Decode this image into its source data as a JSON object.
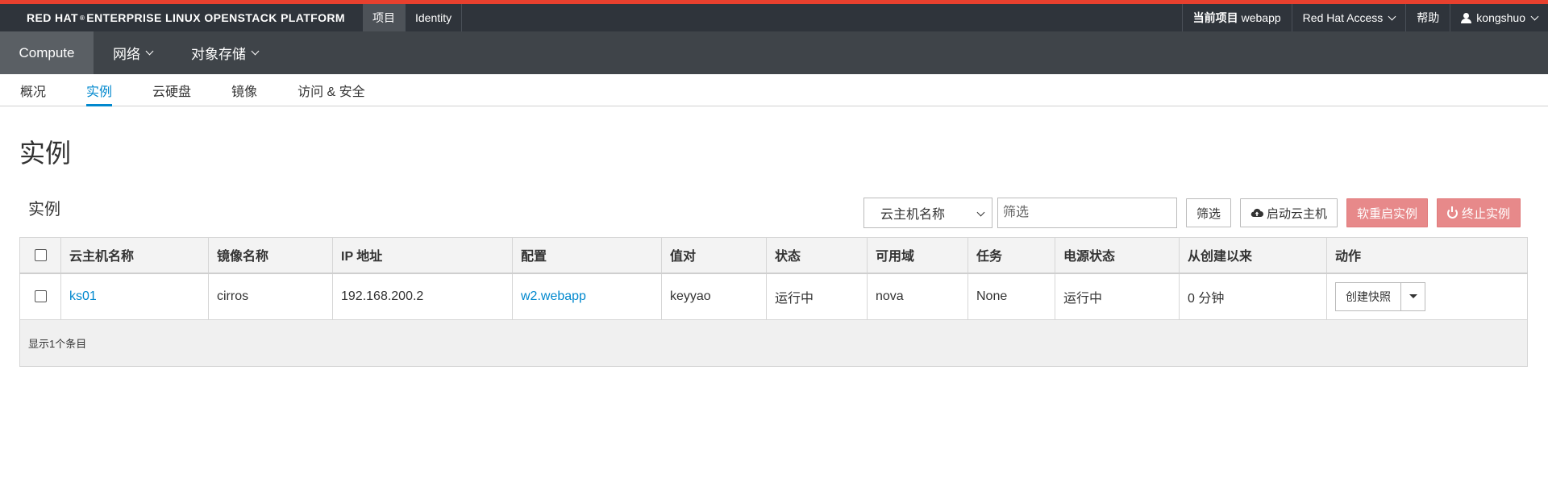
{
  "header": {
    "brand_main": "RED HAT",
    "brand_sup": "®",
    "brand_rest": "ENTERPRISE LINUX OPENSTACK PLATFORM",
    "nav": [
      {
        "label": "项目",
        "active": true
      },
      {
        "label": "Identity",
        "active": false
      }
    ],
    "project_label": "当前项目",
    "project_value": "webapp",
    "access": "Red Hat Access",
    "help": "帮助",
    "user": "kongshuo"
  },
  "mainnav": {
    "compute": "Compute",
    "network": "网络",
    "storage": "对象存储"
  },
  "subnav": {
    "overview": "概况",
    "instances": "实例",
    "volumes": "云硬盘",
    "images": "镜像",
    "access_security": "访问 & 安全"
  },
  "page": {
    "title": "实例",
    "section_title": "实例"
  },
  "toolbar": {
    "filter_select": "云主机名称",
    "filter_placeholder": "筛选",
    "filter_button": "筛选",
    "launch_button": "启动云主机",
    "soft_reboot_button": "软重启实例",
    "terminate_button": "终止实例"
  },
  "table": {
    "headers": [
      "云主机名称",
      "镜像名称",
      "IP 地址",
      "配置",
      "值对",
      "状态",
      "可用域",
      "任务",
      "电源状态",
      "从创建以来",
      "动作"
    ],
    "rows": [
      {
        "name": "ks01",
        "image": "cirros",
        "ip": "192.168.200.2",
        "flavor": "w2.webapp",
        "keypair": "keyyao",
        "status": "运行中",
        "zone": "nova",
        "task": "None",
        "power": "运行中",
        "age": "0 分钟",
        "action": "创建快照"
      }
    ],
    "footer": "显示1个条目"
  },
  "colors": {
    "accent": "#0088ce",
    "topbar": "#2f343b",
    "danger": "#e7898a",
    "redline": "#e8402e"
  }
}
